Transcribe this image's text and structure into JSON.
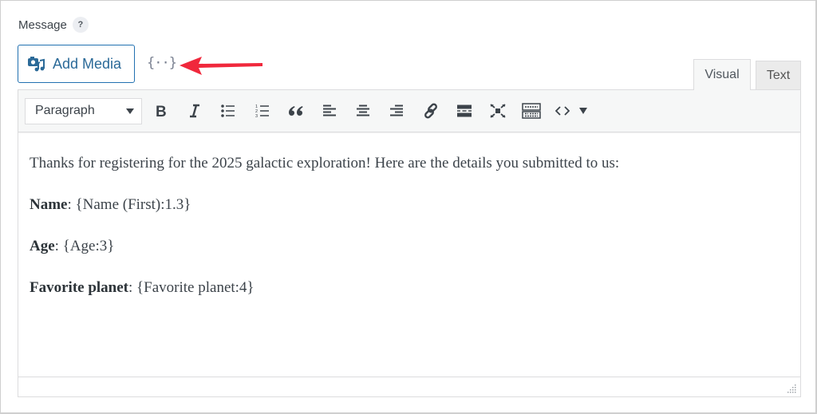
{
  "field": {
    "label": "Message",
    "help_icon": "?"
  },
  "media": {
    "add_media_label": "Add Media",
    "add_media_icon": "media-icon"
  },
  "merge_tag": {
    "label": "{··}",
    "icon": "merge-tag-icon"
  },
  "annotation": {
    "arrow_color": "#f0283c"
  },
  "tabs": [
    {
      "label": "Visual",
      "active": true
    },
    {
      "label": "Text",
      "active": false
    }
  ],
  "toolbar": {
    "format_select": "Paragraph",
    "buttons": [
      "bold",
      "italic",
      "bulleted-list",
      "numbered-list",
      "blockquote",
      "align-left",
      "align-center",
      "align-right",
      "insert-link",
      "read-more",
      "fullscreen",
      "toolbar-toggle",
      "code",
      "more-dropdown"
    ]
  },
  "content": {
    "intro": "Thanks for registering for the 2025 galactic exploration! Here are the details you submitted to us:",
    "fields": [
      {
        "label": "Name",
        "value": ": {Name (First):1.3}"
      },
      {
        "label": "Age",
        "value": ": {Age:3}"
      },
      {
        "label": "Favorite planet",
        "value": ": {Favorite planet:4}"
      }
    ]
  },
  "colors": {
    "accent": "#2271b1",
    "arrow": "#f0283c"
  }
}
